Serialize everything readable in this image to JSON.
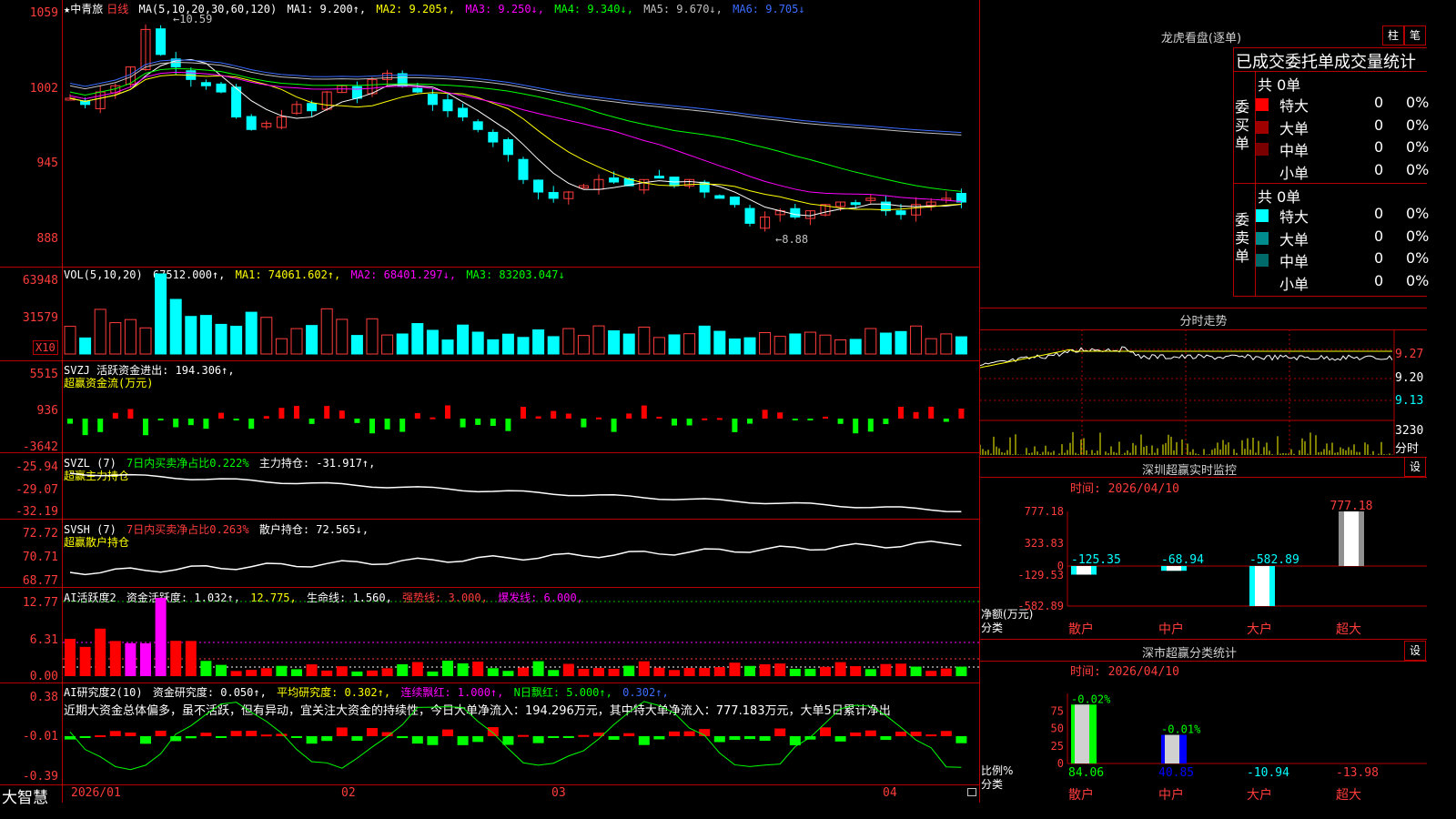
{
  "main": {
    "stock_name": "★中青旅",
    "period": "日线",
    "ma_header": "MA(5,10,20,30,60,120)",
    "ma_values": [
      {
        "label": "MA1: 9.200↑,",
        "color": "#ffffff"
      },
      {
        "label": "MA2: 9.205↑,",
        "color": "#ffff00"
      },
      {
        "label": "MA3: 9.250↓,",
        "color": "#ff00ff"
      },
      {
        "label": "MA4: 9.340↓,",
        "color": "#00ff00"
      },
      {
        "label": "MA5: 9.670↓,",
        "color": "#c0c0c0"
      },
      {
        "label": "MA6: 9.705↓",
        "color": "#3b6cff"
      }
    ],
    "y_ticks": [
      "1059",
      "1002",
      "945",
      "888"
    ],
    "high_label": "10.59",
    "low_label": "8.88"
  },
  "vol": {
    "header": "VOL(5,10,20)",
    "value": "67512.000↑,",
    "ma1": "MA1: 74061.602↑,",
    "ma2": "MA2: 68401.297↓,",
    "ma3": "MA3: 83203.047↓",
    "y_ticks": [
      "63948",
      "31579"
    ],
    "unit_badge": "X10"
  },
  "svzj": {
    "header": "SVZJ  活跃资金进出: 194.306↑,",
    "subtitle": "超赢资金流(万元)",
    "y_ticks": [
      "5515",
      "936",
      "-3642"
    ]
  },
  "svzl": {
    "header_a": "SVZL (7)",
    "header_b": "7日内买卖净占比0.222%",
    "header_c": "主力持仓: -31.917↑,",
    "subtitle": "超赢主力持仓",
    "y_ticks": [
      "-25.94",
      "-29.07",
      "-32.19"
    ]
  },
  "svsh": {
    "header_a": "SVSH (7)",
    "header_b": "7日内买卖净占比0.263%",
    "header_c": "散户持仓: 72.565↓,",
    "subtitle": "超赢散户持仓",
    "y_ticks": [
      "72.72",
      "70.71",
      "68.77"
    ]
  },
  "ai1": {
    "header_a": "AI活跃度2",
    "header_b": "资金活跃度: 1.032↑,",
    "header_c": "12.775,",
    "header_d": "生命线: 1.560,",
    "header_e": "强势线: 3.000,",
    "header_f": "爆发线: 6.000,",
    "y_ticks": [
      "12.77",
      "6.31",
      "0.00"
    ]
  },
  "ai2": {
    "header_a": "AI研究度2(10)",
    "header_b": "资金研究度: 0.050↑,",
    "header_c": "平均研究度: 0.302↑,",
    "header_d": "连续飘红: 1.000↑,",
    "header_e": "N日飘红: 5.000↑,",
    "header_f": "0.302↑,",
    "commentary": "近期大资金总体偏多，虽不活跃，但有异动，宜关注大资金的持续性，今日大单净流入：194.296万元，其中特大单净流入：777.183万元，大单5日累计净出",
    "y_ticks": [
      "0.38",
      "-0.01",
      "-0.39"
    ]
  },
  "xaxis": {
    "brand": "大智慧",
    "dates": [
      "2026/01",
      "02",
      "03",
      "04"
    ]
  },
  "dragon": {
    "title": "龙虎看盘(逐单)",
    "btn_bar": "柱",
    "btn_pen": "笔",
    "table_title": "已成交委托单成交量统计",
    "buy_label": "委买单",
    "sell_label": "委卖单",
    "buy_total": "共 0单",
    "sell_total": "共 0单",
    "buy_rows": [
      {
        "name": "特大",
        "count": "0",
        "pct": "0%",
        "color": "#ff0000"
      },
      {
        "name": "大单",
        "count": "0",
        "pct": "0%",
        "color": "#a00000"
      },
      {
        "name": "中单",
        "count": "0",
        "pct": "0%",
        "color": "#7a0000"
      },
      {
        "name": "小单",
        "count": "0",
        "pct": "0%",
        "color": "#000000"
      }
    ],
    "sell_rows": [
      {
        "name": "特大",
        "count": "0",
        "pct": "0%",
        "color": "#00ffff"
      },
      {
        "name": "大单",
        "count": "0",
        "pct": "0%",
        "color": "#008c8c"
      },
      {
        "name": "中单",
        "count": "0",
        "pct": "0%",
        "color": "#006a6a"
      },
      {
        "name": "小单",
        "count": "0",
        "pct": "0%",
        "color": "#000000"
      }
    ]
  },
  "intraday": {
    "title": "分时走势",
    "price_ticks": [
      "9.27",
      "9.20",
      "9.13"
    ],
    "vol_tick": "3230",
    "vol_unit": "分时"
  },
  "sz_monitor": {
    "title": "深圳超赢实时监控",
    "settings_btn": "设",
    "time_label": "时间: 2026/04/10",
    "y_ticks": [
      "777.18",
      "323.83",
      "0",
      "-129.53",
      "-582.89"
    ],
    "y_unit": "净额(万元)",
    "x_unit": "分类",
    "chart_data": {
      "type": "bar",
      "categories": [
        "散户",
        "中户",
        "大户",
        "超大"
      ],
      "values": [
        -125.35,
        -68.94,
        -582.89,
        777.18
      ],
      "value_labels": [
        "-125.35",
        "-68.94",
        "-582.89",
        "777.18"
      ],
      "ylim": [
        -582.89,
        777.18
      ]
    }
  },
  "sz_class": {
    "title": "深市超赢分类统计",
    "settings_btn": "设",
    "time_label": "时间: 2026/04/10",
    "y_ticks": [
      "75",
      "50",
      "25",
      "0"
    ],
    "y_unit": "比例%",
    "x_unit": "分类",
    "chart_data": {
      "type": "bar",
      "categories": [
        "散户",
        "中户",
        "大户",
        "超大"
      ],
      "values": [
        84.06,
        40.85,
        -10.94,
        -13.98
      ],
      "change_labels": [
        "-0.02%",
        "-0.01%",
        "",
        ""
      ],
      "value_labels": [
        "84.06",
        "40.85",
        "-10.94",
        "-13.98"
      ],
      "ylim": [
        0,
        100
      ]
    }
  }
}
